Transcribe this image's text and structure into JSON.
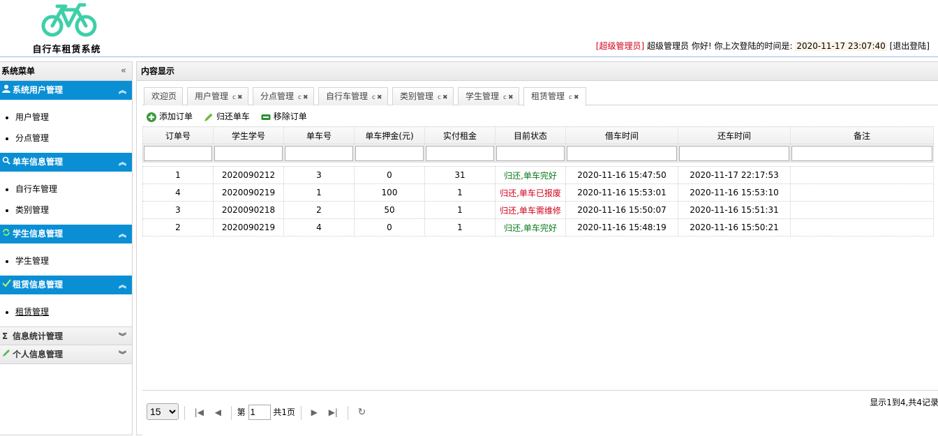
{
  "header": {
    "logo_title": "自行车租赁系统",
    "role": "[超级管理员]",
    "user": "超级管理员",
    "greeting": "你好! 你上次登陆的时间是:",
    "last_login": "2020-11-17 23:07:40",
    "logout": "[退出登陆]",
    "logo_color": "#3ecfa8"
  },
  "sidebar": {
    "title": "系统菜单",
    "title_chevron": "«",
    "groups": [
      {
        "label": "系统用户管理",
        "icon": "user-icon",
        "items": [
          "用户管理",
          "分点管理"
        ]
      },
      {
        "label": "单车信息管理",
        "icon": "search-icon",
        "items": [
          "自行车管理",
          "类别管理"
        ]
      },
      {
        "label": "学生信息管理",
        "icon": "refresh-icon",
        "items": [
          "学生管理"
        ]
      },
      {
        "label": "租赁信息管理",
        "icon": "check-icon",
        "items": [
          "租赁管理"
        ]
      },
      {
        "label": "信息统计管理",
        "icon": "sigma-icon",
        "items": []
      },
      {
        "label": "个人信息管理",
        "icon": "pencil-icon",
        "items": []
      }
    ]
  },
  "main": {
    "title": "内容显示",
    "tabs": [
      "欢迎页",
      "用户管理",
      "分点管理",
      "自行车管理",
      "类别管理",
      "学生管理",
      "租赁管理"
    ],
    "toolbar": {
      "add": "添加订单",
      "return": "归还单车",
      "remove": "移除订单"
    },
    "columns": [
      "订单号",
      "学生学号",
      "单车号",
      "单车押金(元)",
      "实付租金",
      "目前状态",
      "借车时间",
      "还车时间",
      "备注"
    ],
    "rows": [
      [
        "1",
        "2020090212",
        "3",
        "0",
        "31",
        "归还,单车完好",
        "2020-11-16 15:47:50",
        "2020-11-17 22:17:53",
        ""
      ],
      [
        "4",
        "2020090219",
        "1",
        "100",
        "1",
        "归还,单车已报废",
        "2020-11-16 15:53:01",
        "2020-11-16 15:53:10",
        ""
      ],
      [
        "3",
        "2020090218",
        "2",
        "50",
        "1",
        "归还,单车需维修",
        "2020-11-16 15:50:07",
        "2020-11-16 15:51:31",
        ""
      ],
      [
        "2",
        "2020090219",
        "4",
        "0",
        "1",
        "归还,单车完好",
        "2020-11-16 15:48:19",
        "2020-11-16 15:50:21",
        ""
      ]
    ],
    "status_colors": {
      "good": "#0a7a1b",
      "bad": "#d0021b"
    }
  },
  "pager": {
    "page_size": "15",
    "page_prefix": "第",
    "page_value": "1",
    "page_total": "共1页",
    "info": "显示1到4,共4记录"
  }
}
